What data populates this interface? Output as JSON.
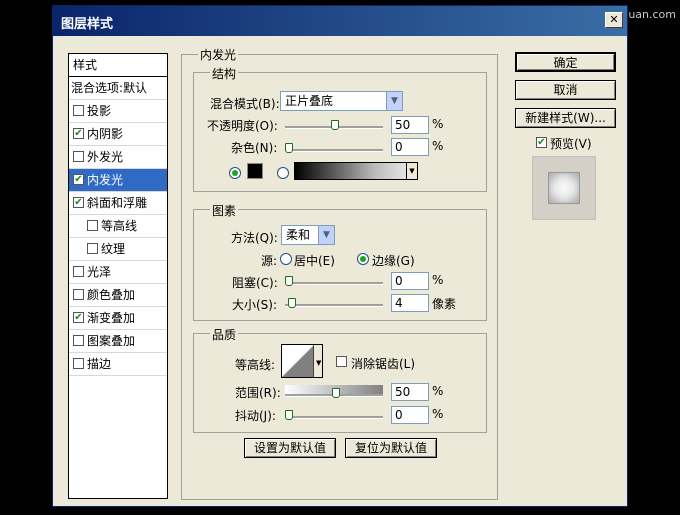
{
  "watermark": "思缘设计论坛 www.missyuan.com",
  "window": {
    "title": "图层样式",
    "close_glyph": "✕"
  },
  "style_list": {
    "header": "样式",
    "blend_item": "混合选项:默认",
    "items": [
      {
        "label": "投影",
        "checked": false,
        "indent": false
      },
      {
        "label": "内阴影",
        "checked": true,
        "indent": false
      },
      {
        "label": "外发光",
        "checked": false,
        "indent": false
      },
      {
        "label": "内发光",
        "checked": true,
        "indent": false,
        "selected": true
      },
      {
        "label": "斜面和浮雕",
        "checked": true,
        "indent": false
      },
      {
        "label": "等高线",
        "checked": false,
        "indent": true
      },
      {
        "label": "纹理",
        "checked": false,
        "indent": true
      },
      {
        "label": "光泽",
        "checked": false,
        "indent": false
      },
      {
        "label": "颜色叠加",
        "checked": false,
        "indent": false
      },
      {
        "label": "渐变叠加",
        "checked": true,
        "indent": false
      },
      {
        "label": "图案叠加",
        "checked": false,
        "indent": false
      },
      {
        "label": "描边",
        "checked": false,
        "indent": false
      }
    ]
  },
  "panel": {
    "title": "内发光",
    "structure": {
      "title": "结构",
      "blend_mode_label": "混合模式(B):",
      "blend_mode_value": "正片叠底",
      "opacity_label": "不透明度(O):",
      "opacity_value": "50",
      "noise_label": "杂色(N):",
      "noise_value": "0",
      "percent": "%"
    },
    "elements": {
      "title": "图素",
      "method_label": "方法(Q):",
      "method_value": "柔和",
      "source_label": "源:",
      "source_center": "居中(E)",
      "source_edge": "边缘(G)",
      "choke_label": "阻塞(C):",
      "choke_value": "0",
      "size_label": "大小(S):",
      "size_value": "4",
      "px": "像素",
      "percent": "%"
    },
    "quality": {
      "title": "品质",
      "contour_label": "等高线:",
      "antialias_label": "消除锯齿(L)",
      "range_label": "范围(R):",
      "range_value": "50",
      "jitter_label": "抖动(J):",
      "jitter_value": "0",
      "percent": "%"
    },
    "make_default": "设置为默认值",
    "reset_default": "复位为默认值"
  },
  "buttons": {
    "ok": "确定",
    "cancel": "取消",
    "new_style": "新建样式(W)...",
    "preview": "预览(V)"
  },
  "colors": {
    "title_start": "#0a246a",
    "title_end": "#3a6ea5",
    "selected_row": "#316ac5",
    "dialog_bg": "#ece9d8",
    "glow_color": "#000000"
  }
}
